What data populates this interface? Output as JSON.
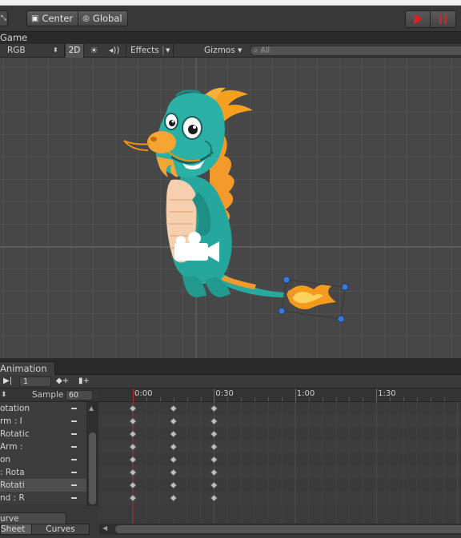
{
  "toolbar": {
    "corner_glyph": "⤡",
    "pivot_label": "Center",
    "space_label": "Global",
    "play_icon": "play-icon",
    "pause_icon": "pause-icon"
  },
  "game_tab": {
    "label": "Game"
  },
  "scene_toolbar": {
    "shading_mode": "RGB",
    "mode_2d": "2D",
    "effects": "Effects",
    "gizmos": "Gizmos",
    "search_placeholder": "All"
  },
  "animation": {
    "tab_label": "Animation",
    "frame_value": "1",
    "sample_label": "Sample",
    "sample_value": "60",
    "ruler_labels": [
      "0:00",
      "0:30",
      "1:00",
      "1:30"
    ],
    "properties": [
      {
        "label": "otation",
        "selected": false
      },
      {
        "label": "rm : I",
        "selected": false
      },
      {
        "label": "Rotatic",
        "selected": false
      },
      {
        "label": "Arm :",
        "selected": false
      },
      {
        "label": "on",
        "selected": false
      },
      {
        "label": ": Rota",
        "selected": false
      },
      {
        "label": "Rotati",
        "selected": true
      },
      {
        "label": "nd : R",
        "selected": false
      }
    ],
    "keyframe_times": [
      "0:00",
      "0:15",
      "0:30"
    ],
    "curve_button": "urve",
    "bottom_tabs": [
      "Sheet",
      "Curves"
    ]
  },
  "colors": {
    "accent_red": "#d62222",
    "playhead": "#c0282a",
    "handle_blue": "#3a7bd5"
  }
}
